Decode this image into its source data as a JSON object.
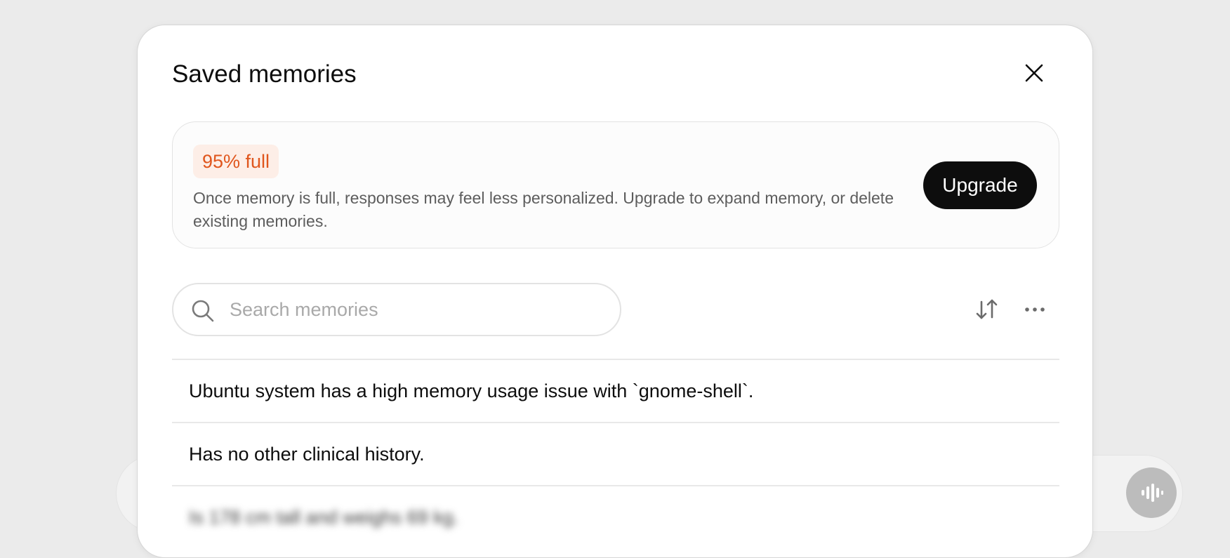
{
  "modal": {
    "title": "Saved memories"
  },
  "usage": {
    "percent_full": 95,
    "badge": "95% full",
    "description": "Once memory is full, responses may feel less personalized. Upgrade to expand memory, or delete existing memories.",
    "upgrade_label": "Upgrade",
    "badge_color": "#e0561d"
  },
  "search": {
    "placeholder": "Search memories",
    "value": ""
  },
  "toolbar": {
    "sort_icon": "sort-arrows-icon",
    "more_icon": "more-horizontal-icon"
  },
  "memories": [
    {
      "text": "Ubuntu system has a high memory usage issue with `gnome-shell`."
    },
    {
      "text": "Has no other clinical history."
    },
    {
      "text": "Is 178 cm tall and weighs 69 kg."
    }
  ]
}
